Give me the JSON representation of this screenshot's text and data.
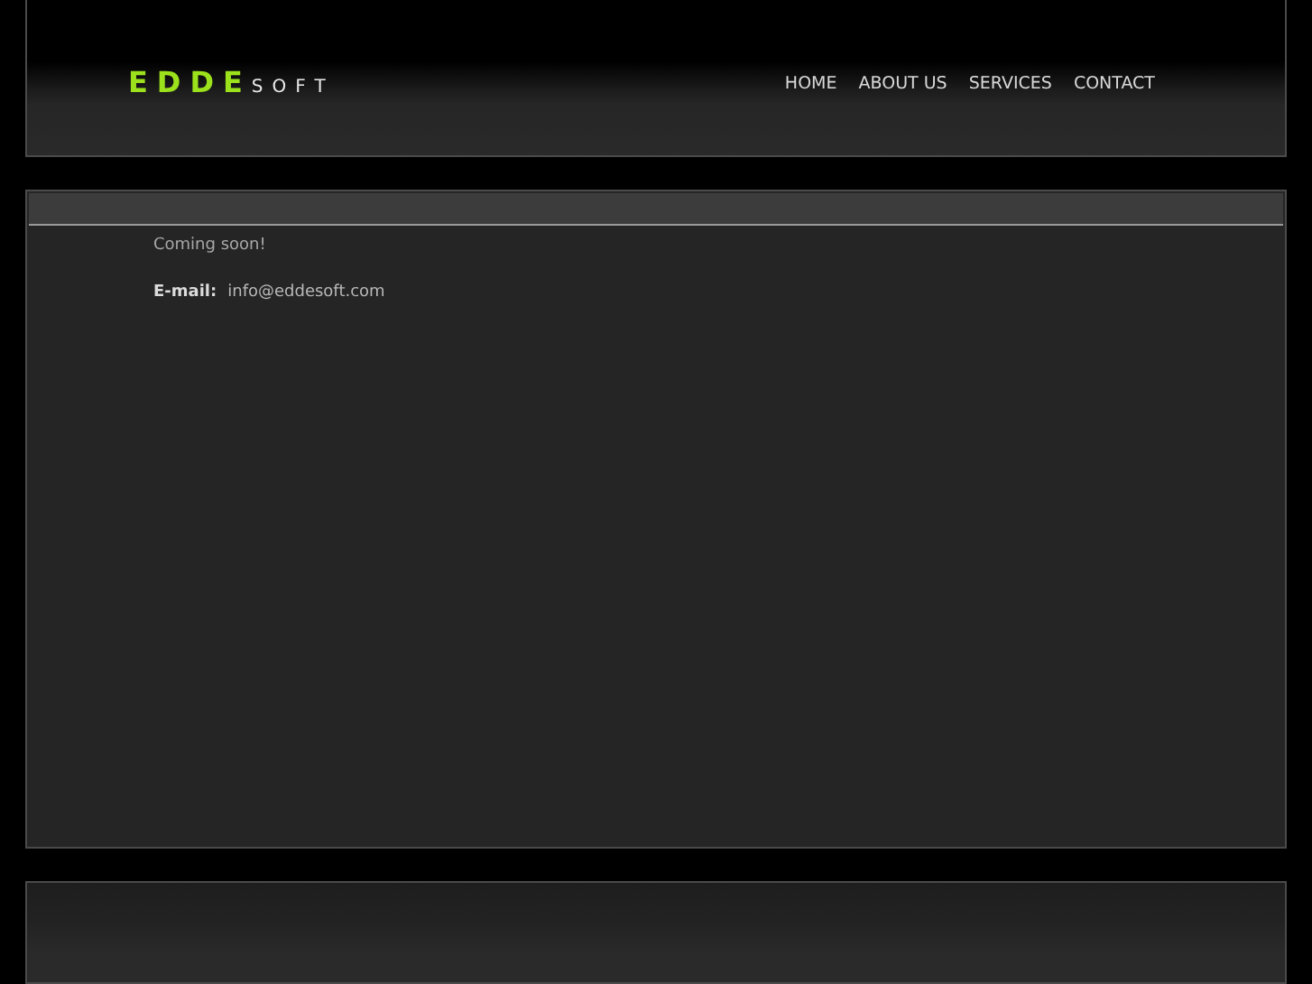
{
  "logo": {
    "main": "EDDE",
    "sub": "SOFT"
  },
  "nav": [
    {
      "label": "HOME"
    },
    {
      "label": "ABOUT US"
    },
    {
      "label": "SERVICES"
    },
    {
      "label": "CONTACT"
    }
  ],
  "content": {
    "intro": "Coming soon!",
    "email_label": "E-mail:",
    "email": "info@eddesoft.com"
  }
}
